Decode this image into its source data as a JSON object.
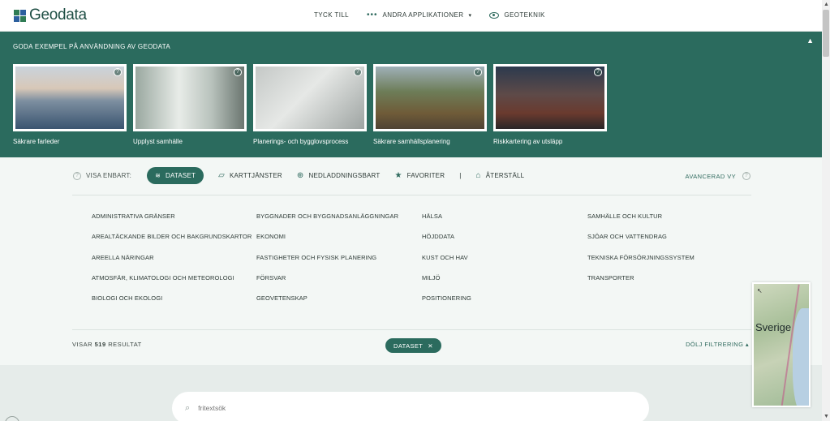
{
  "header": {
    "logo_text": "Geodata",
    "nav": [
      {
        "label": "TYCK TILL"
      },
      {
        "label": "ANDRA APPLIKATIONER",
        "dots": "•••",
        "caret": "▾"
      },
      {
        "label": "GEOTEKNIK"
      }
    ]
  },
  "examples": {
    "title": "GODA EXEMPEL PÅ ANVÄNDNING AV GEODATA",
    "collapse_icon": "▲",
    "cards": [
      {
        "label": "Säkrare farleder"
      },
      {
        "label": "Upplyst samhälle"
      },
      {
        "label": "Planerings- och bygglovsprocess"
      },
      {
        "label": "Säkrare samhällsplanering"
      },
      {
        "label": "Riskkartering av utsläpp"
      }
    ]
  },
  "filter": {
    "visa_label": "VISA ENBART:",
    "buttons": [
      {
        "label": "DATASET",
        "icon": "≋"
      },
      {
        "label": "KARTTJÄNSTER",
        "icon": "▱"
      },
      {
        "label": "NEDLADDNINGSBART",
        "icon": "⊕"
      },
      {
        "label": "FAVORITER",
        "icon": "★"
      },
      {
        "label": "ÅTERSTÄLL",
        "icon": "⌂"
      }
    ],
    "separator": "|",
    "advanced_label": "AVANCERAD VY",
    "categories": [
      [
        "ADMINISTRATIVA GRÄNSER",
        "AREALTÄCKANDE BILDER OCH BAKGRUNDSKARTOR",
        "AREELLA NÄRINGAR",
        "ATMOSFÄR, KLIMATOLOGI OCH METEOROLOGI",
        "BIOLOGI OCH EKOLOGI"
      ],
      [
        "BYGGNADER OCH BYGGNADSANLÄGGNINGAR",
        "EKONOMI",
        "FASTIGHETER OCH FYSISK PLANERING",
        "FÖRSVAR",
        "GEOVETENSKAP"
      ],
      [
        "HÄLSA",
        "HÖJDDATA",
        "KUST OCH HAV",
        "MILJÖ",
        "POSITIONERING"
      ],
      [
        "SAMHÄLLE OCH KULTUR",
        "SJÖAR OCH VATTENDRAG",
        "TEKNISKA FÖRSÖRJNINGSSYSTEM",
        "TRANSPORTER"
      ]
    ],
    "results_prefix": "VISAR",
    "results_count": "519",
    "results_suffix": "RESULTAT",
    "active_tag": "DATASET",
    "tag_close": "✕",
    "hide_filter": "DÖLJ FILTRERING ▴"
  },
  "search": {
    "placeholder": "fritextsök"
  },
  "minimap": {
    "label": "Sverige"
  }
}
